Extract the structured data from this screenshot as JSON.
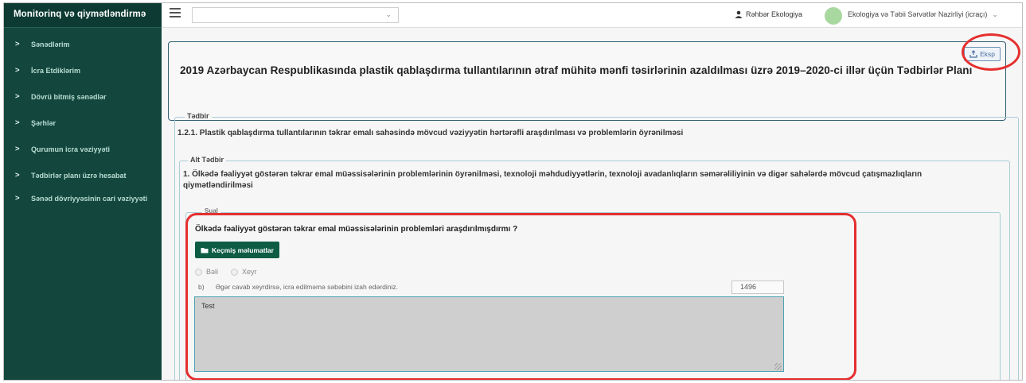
{
  "sidebar": {
    "brand": "Monitorinq və qiymətləndirmə",
    "items": [
      {
        "label": "Sənədlərim"
      },
      {
        "label": "İcra Etdiklərim"
      },
      {
        "label": "Dövrü bitmiş sənədlər"
      },
      {
        "label": "Şərhlər"
      },
      {
        "label": "Qurumun icra vəziyyəti"
      },
      {
        "label": "Tədbirlər planı üzrə hesabat"
      },
      {
        "label": "Sənəd dövriyyəsinin cari vəziyyəti"
      }
    ]
  },
  "topbar": {
    "select_caret": "⌄",
    "user_role": "Rəhbər Ekologiya",
    "ministry": "Ekologiya və Təbii Sərvətlər Nazirliyi (icraçı)"
  },
  "title_panel": {
    "title": "2019 Azərbaycan Respublikasında plastik qablaşdırma tullantılarının ətraf mühitə mənfi təsirlərinin azaldılması üzrə 2019–2020-ci illər üçün Tədbirlər Planı",
    "export_label": "Eksp"
  },
  "tedbir": {
    "legend": "Tədbir",
    "text": "1.2.1. Plastik qablaşdırma tullantılarının təkrar emalı sahəsində mövcud vəziyyətin hərtərəfli araşdırılması və problemlərin öyrənilməsi"
  },
  "alt_tedbir": {
    "legend": "Alt Tədbir",
    "text": "1. Ölkədə fəaliyyət göstərən təkrar emal müəssisələrinin problemlərinin öyrənilməsi, texnoloji məhdudiyyətlərin, texnoloji avadanlıqların səmərəliliyinin və digər sahələrdə mövcud çatışmazlıqların qiymətləndirilməsi"
  },
  "sual": {
    "legend": "Sual",
    "question": "Ölkədə fəaliyyət göstərən təkrar emal müəssisələrinin problemləri araşdırılmışdırmı ?",
    "history_button": "Keçmiş məlumatlar",
    "option_yes": "Bəli",
    "option_no": "Xeyr",
    "prompt_letter": "b)",
    "prompt": "Əgər cavab xeyrdirsə, icra edilməmə səbəbini izah edərdiniz.",
    "counter": "1496",
    "answer": "Test"
  },
  "colors": {
    "sidebar_bg": "#13473d",
    "highlight": "#e52f2f",
    "history_button": "#0f5c45"
  }
}
